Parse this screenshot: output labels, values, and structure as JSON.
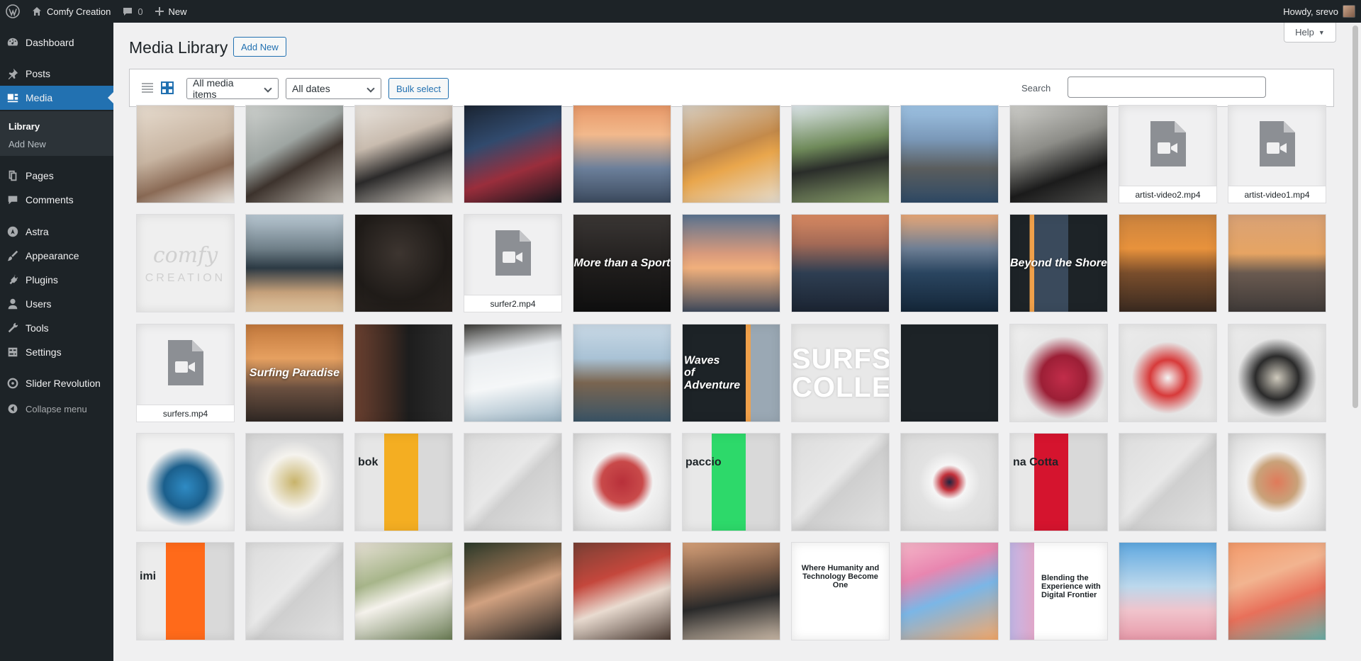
{
  "admin_bar": {
    "site_name": "Comfy Creation",
    "comments_count": "0",
    "new_label": "New",
    "greeting": "Howdy, srevo"
  },
  "sidebar": {
    "items": [
      {
        "label": "Dashboard",
        "icon": "dashboard-icon"
      },
      {
        "label": "Posts",
        "icon": "pin-icon"
      },
      {
        "label": "Media",
        "icon": "media-icon",
        "current": true
      },
      {
        "label": "Pages",
        "icon": "pages-icon"
      },
      {
        "label": "Comments",
        "icon": "comment-icon"
      },
      {
        "label": "Astra",
        "icon": "astra-icon"
      },
      {
        "label": "Appearance",
        "icon": "brush-icon"
      },
      {
        "label": "Plugins",
        "icon": "plug-icon"
      },
      {
        "label": "Users",
        "icon": "user-icon"
      },
      {
        "label": "Tools",
        "icon": "wrench-icon"
      },
      {
        "label": "Settings",
        "icon": "settings-icon"
      },
      {
        "label": "Slider Revolution",
        "icon": "slider-icon"
      },
      {
        "label": "Collapse menu",
        "icon": "collapse-icon"
      }
    ],
    "media_submenu": [
      "Library",
      "Add New"
    ]
  },
  "page": {
    "title": "Media Library",
    "add_new": "Add New",
    "help": "Help"
  },
  "toolbar": {
    "filter_type": "All media items",
    "filter_date": "All dates",
    "bulk_select": "Bulk select",
    "search_label": "Search"
  },
  "media": {
    "video_files": [
      "artist-video2.mp4",
      "artist-video1.mp4",
      "surfer2.mp4",
      "surfers.mp4"
    ],
    "overlay_texts": {
      "more_than_a_sport": "More than a Sport",
      "beyond_the_shore": "Beyond the Shore",
      "surfing_paradise": "Surfing Paradise",
      "waves_of_adventure": "Waves of Adventure",
      "surfso_collective": "SURFSO COLLECTIVE",
      "comfy_logo": "comfy",
      "comfy_logo_sub": "CREATION",
      "bok": "bok",
      "paccio": "paccio",
      "na_cotta": "na Cotta",
      "imi": "imi",
      "humanity": "Where Humanity and Technology Become One",
      "blending": "Blending the Experience with Digital Frontier"
    }
  },
  "colors": {
    "admin_dark": "#1d2327",
    "accent": "#2271b1"
  }
}
